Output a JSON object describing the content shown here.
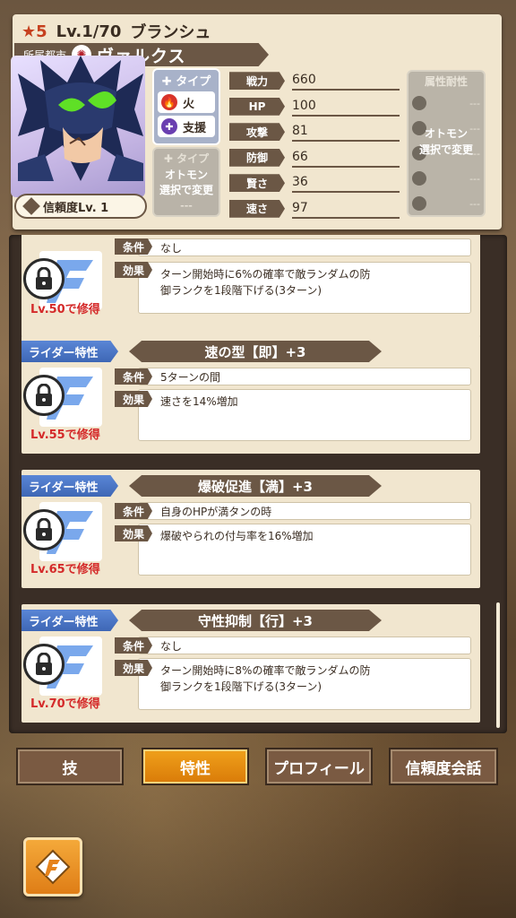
{
  "header": {
    "rarity": "5",
    "level": "Lv.1/70",
    "name": "ブランシュ",
    "city_label": "所属都市",
    "city_name": "ヴァルクス",
    "trust": "信頼度Lv. 1"
  },
  "type_panel": {
    "title": "タイプ",
    "types": [
      "火",
      "支援"
    ],
    "otomon_title": "タイプ",
    "otomon_text": [
      "オトモン",
      "選択で変更"
    ],
    "otomon_dash": "---"
  },
  "stats": [
    {
      "label": "戦力",
      "value": "660"
    },
    {
      "label": "HP",
      "value": "100"
    },
    {
      "label": "攻撃",
      "value": "81"
    },
    {
      "label": "防御",
      "value": "66"
    },
    {
      "label": "賢さ",
      "value": "36"
    },
    {
      "label": "速さ",
      "value": "97"
    }
  ],
  "resist": {
    "title": "属性耐性",
    "dash": "---",
    "overlay": [
      "オトモン",
      "選択で変更"
    ]
  },
  "traits": [
    {
      "tag": "",
      "name": "",
      "cond_label": "条件",
      "cond": "なし",
      "eff_label": "効果",
      "effect": [
        "ターン開始時に6%の確率で敵ランダムの防",
        "御ランクを1段階下げる(3ターン)"
      ],
      "learn": "Lv.50で修得"
    },
    {
      "tag": "ライダー特性",
      "name": "速の型【即】+3",
      "cond_label": "条件",
      "cond": "5ターンの間",
      "eff_label": "効果",
      "effect": [
        "速さを14%増加",
        ""
      ],
      "learn": "Lv.55で修得"
    },
    {
      "tag": "ライダー特性",
      "name": "爆破促進【満】+3",
      "cond_label": "条件",
      "cond": "自身のHPが満タンの時",
      "eff_label": "効果",
      "effect": [
        "爆破やられの付与率を16%増加",
        ""
      ],
      "learn": "Lv.65で修得"
    },
    {
      "tag": "ライダー特性",
      "name": "守性抑制【行】+3",
      "cond_label": "条件",
      "cond": "なし",
      "eff_label": "効果",
      "effect": [
        "ターン開始時に8%の確率で敵ランダムの防",
        "御ランクを1段階下げる(3ターン)"
      ],
      "learn": "Lv.70で修得"
    }
  ],
  "tabs": [
    "技",
    "特性",
    "プロフィール",
    "信頼度会話"
  ],
  "active_tab": "特性",
  "colors": {
    "accent": "#e88a12",
    "rider_tag": "#4a74c6",
    "lock_text": "#d42a2a",
    "frame": "#6b5745"
  }
}
